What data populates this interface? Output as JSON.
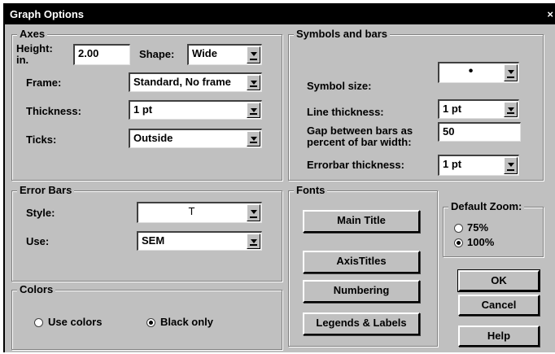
{
  "dialog": {
    "title": "Graph Options",
    "close": "×"
  },
  "axes": {
    "group_label": "Axes",
    "height_label": "Height:",
    "height_unit": "in.",
    "height_value": "2.00",
    "shape_label": "Shape:",
    "shape_value": "Wide",
    "frame_label": "Frame:",
    "frame_value": "Standard, No frame",
    "thickness_label": "Thickness:",
    "thickness_value": "1 pt",
    "ticks_label": "Ticks:",
    "ticks_value": "Outside"
  },
  "symbols": {
    "group_label": "Symbols and bars",
    "symbol_size_label": "Symbol size:",
    "symbol_size_value": "•",
    "line_thickness_label": "Line thickness:",
    "line_thickness_value": "1 pt",
    "gap_label_1": "Gap between bars as",
    "gap_label_2": "percent of bar width:",
    "gap_value": "50",
    "errorbar_label": "Errorbar thickness:",
    "errorbar_value": "1 pt"
  },
  "error_bars": {
    "group_label": "Error Bars",
    "style_label": "Style:",
    "style_value": "T",
    "use_label": "Use:",
    "use_value": "SEM"
  },
  "colors": {
    "group_label": "Colors",
    "option_colors": "Use colors",
    "option_black": "Black only",
    "selected": "black"
  },
  "fonts": {
    "group_label": "Fonts",
    "main_title": "Main Title",
    "axis_titles": "AxisTitles",
    "numbering": "Numbering",
    "legends": "Legends & Labels"
  },
  "zoom": {
    "group_label": "Default Zoom:",
    "option_75": "75%",
    "option_100": "100%",
    "selected": "100"
  },
  "buttons": {
    "ok": "OK",
    "cancel": "Cancel",
    "help": "Help"
  }
}
